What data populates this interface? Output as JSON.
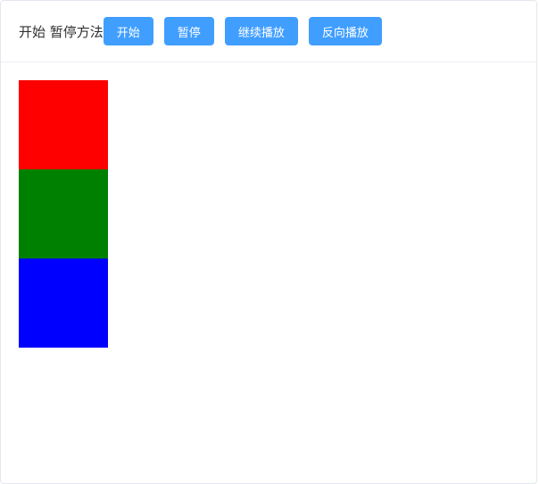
{
  "header": {
    "title": "开始 暂停方法",
    "buttons": [
      {
        "label": "开始"
      },
      {
        "label": "暂停"
      },
      {
        "label": "继续播放"
      },
      {
        "label": "反向播放"
      }
    ]
  },
  "boxes": [
    {
      "color": "#ff0000"
    },
    {
      "color": "#008000"
    },
    {
      "color": "#0000ff"
    }
  ],
  "colors": {
    "button": "#409eff",
    "border": "#ebeef5"
  }
}
